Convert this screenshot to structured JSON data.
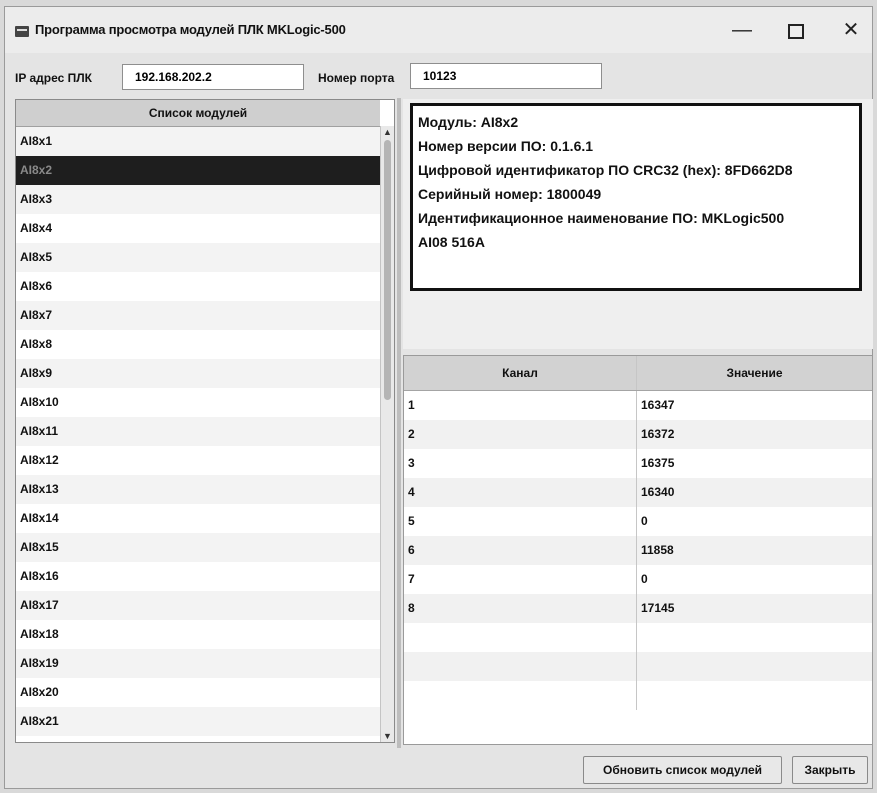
{
  "window": {
    "title": "Программа просмотра модулей ПЛК MKLogic-500"
  },
  "controls": {
    "minimize": "—",
    "close": "✕"
  },
  "connection": {
    "ip_label": "IP адрес ПЛК",
    "ip_value": "192.168.202.2",
    "port_label": "Номер порта",
    "port_value": "10123"
  },
  "module_list": {
    "header": "Список модулей",
    "items": [
      "AI8x1",
      "AI8x2",
      "AI8x3",
      "AI8x4",
      "AI8x5",
      "AI8x6",
      "AI8x7",
      "AI8x8",
      "AI8x9",
      "AI8x10",
      "AI8x11",
      "AI8x12",
      "AI8x13",
      "AI8x14",
      "AI8x15",
      "AI8x16",
      "AI8x17",
      "AI8x18",
      "AI8x19",
      "AI8x20",
      "AI8x21"
    ],
    "selected": "AI8x2"
  },
  "info": {
    "lines": [
      "Модуль: AI8x2",
      "Номер версии ПО: 0.1.6.1",
      "Цифровой идентификатор ПО CRC32 (hex): 8FD662D8",
      "Серийный номер: 1800049",
      "Идентификационное наименование ПО: MKLogic500",
      "AI08 516A"
    ]
  },
  "channels": {
    "headers": {
      "channel": "Канал",
      "value": "Значение"
    },
    "rows": [
      {
        "channel": "1",
        "value": "16347"
      },
      {
        "channel": "2",
        "value": "16372"
      },
      {
        "channel": "3",
        "value": "16375"
      },
      {
        "channel": "4",
        "value": "16340"
      },
      {
        "channel": "5",
        "value": "0"
      },
      {
        "channel": "6",
        "value": "11858"
      },
      {
        "channel": "7",
        "value": "0"
      },
      {
        "channel": "8",
        "value": "17145"
      },
      {
        "channel": "",
        "value": ""
      },
      {
        "channel": "",
        "value": ""
      },
      {
        "channel": "",
        "value": ""
      }
    ]
  },
  "buttons": {
    "refresh": "Обновить список модулей",
    "close": "Закрыть"
  }
}
